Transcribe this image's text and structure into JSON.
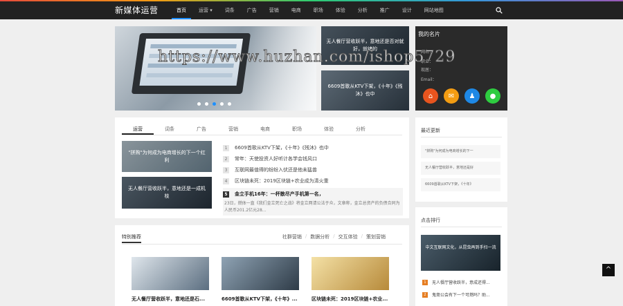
{
  "header": {
    "brand": "新媒体运营",
    "nav": [
      {
        "label": "首页",
        "active": true
      },
      {
        "label": "运营 ▾"
      },
      {
        "label": "词条"
      },
      {
        "label": "广告"
      },
      {
        "label": "营销"
      },
      {
        "label": "电商"
      },
      {
        "label": "职场"
      },
      {
        "label": "体验"
      },
      {
        "label": "分析"
      },
      {
        "label": "推广"
      },
      {
        "label": "设计"
      },
      {
        "label": "网站地图"
      }
    ]
  },
  "slider": {
    "thumbs": [
      {
        "caption": "无人餐厅营收跃半，意地还是否对就好，就绪的"
      },
      {
        "caption": "6609首歌从KTV下架，《十年》《残沐》也中"
      }
    ]
  },
  "card": {
    "title": "我的名片",
    "lines": [
      "网名：",
      "职业：",
      "现居：",
      "Email："
    ]
  },
  "tabs_section": {
    "tabs": [
      "运营",
      "词条",
      "广告",
      "营销",
      "电商",
      "职场",
      "体验",
      "分析"
    ],
    "thumbs": [
      {
        "caption": "\"拼购\"为何成为电商增长的下一个红利"
      },
      {
        "caption": "无人餐厅营收跃半，意地还是一成机枝"
      }
    ],
    "news": [
      {
        "n": "1",
        "text": "6609首歌从KTV下架，《十年》《残沐》也中"
      },
      {
        "n": "2",
        "text": "常年：天使投资人好听计各学会钱风口"
      },
      {
        "n": "3",
        "text": "互联网最值得的纷纷入伏还是他未猛兽"
      },
      {
        "n": "4",
        "text": "区块链未死：2019区块链+农业成为清火重"
      }
    ],
    "feature": {
      "n": "5",
      "title": "金立手机16年：一杯散尽产手机第一名，",
      "body": "23日，燃体一直《我们金立死亡之战》将金立两请公法于众，文章称，金立总资产的负债合同为人民币201.2亿元28..."
    }
  },
  "recent": {
    "title": "最近更新",
    "items": [
      "\"拼购\"为何成为电商增长的下一",
      "无人餐厅营收跃半，意地还是好",
      "6609首歌从KTV下架，《十年》"
    ]
  },
  "recommend": {
    "title": "特别推荐",
    "tabs": [
      "社群营销",
      "数据分析",
      "交互体验",
      "策划营销"
    ],
    "items": [
      {
        "caption": "无人餐厅营收跃半，意地还是石..."
      },
      {
        "caption": "6609首歌从KTV下架，《十年》..."
      },
      {
        "caption": "区块链未死：2019区块链+农业..."
      }
    ]
  },
  "ranking": {
    "title": "点击排行",
    "image_caption": "中文互联网文化，从昆虫再到手扫一流",
    "items": [
      {
        "n": "1",
        "text": "无人餐厅营收跃半，意成还得..."
      },
      {
        "n": "2",
        "text": "鬼斋公会有下一个可燃吗？助..."
      }
    ]
  },
  "watermark": "https://www.huzhan.com/ishop5729",
  "back_top": "^"
}
